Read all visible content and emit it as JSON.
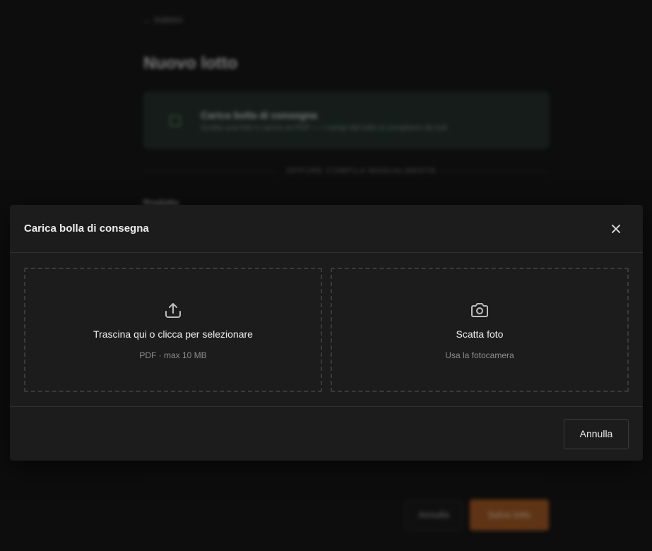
{
  "background": {
    "back_link": "← Indietro",
    "page_title": "Nuovo lotto",
    "upload_card": {
      "title": "Carica bolla di consegna",
      "subtitle": "Scatta una foto o carica un PDF — i campi del lotto si compilano da soli"
    },
    "divider_text": "OPPURE COMPILA MANUALMENTE",
    "section_label": "Prodotto",
    "cancel_label": "Annulla",
    "save_label": "Salva lotto",
    "accent_color": "#a3551c"
  },
  "modal": {
    "title": "Carica bolla di consegna",
    "close_icon": "close-icon",
    "options": [
      {
        "icon": "upload-icon",
        "title": "Trascina qui o clicca per selezionare",
        "subtitle": "PDF · max 10 MB"
      },
      {
        "icon": "camera-icon",
        "title": "Scatta foto",
        "subtitle": "Usa la fotocamera"
      }
    ],
    "cancel_label": "Annulla"
  }
}
